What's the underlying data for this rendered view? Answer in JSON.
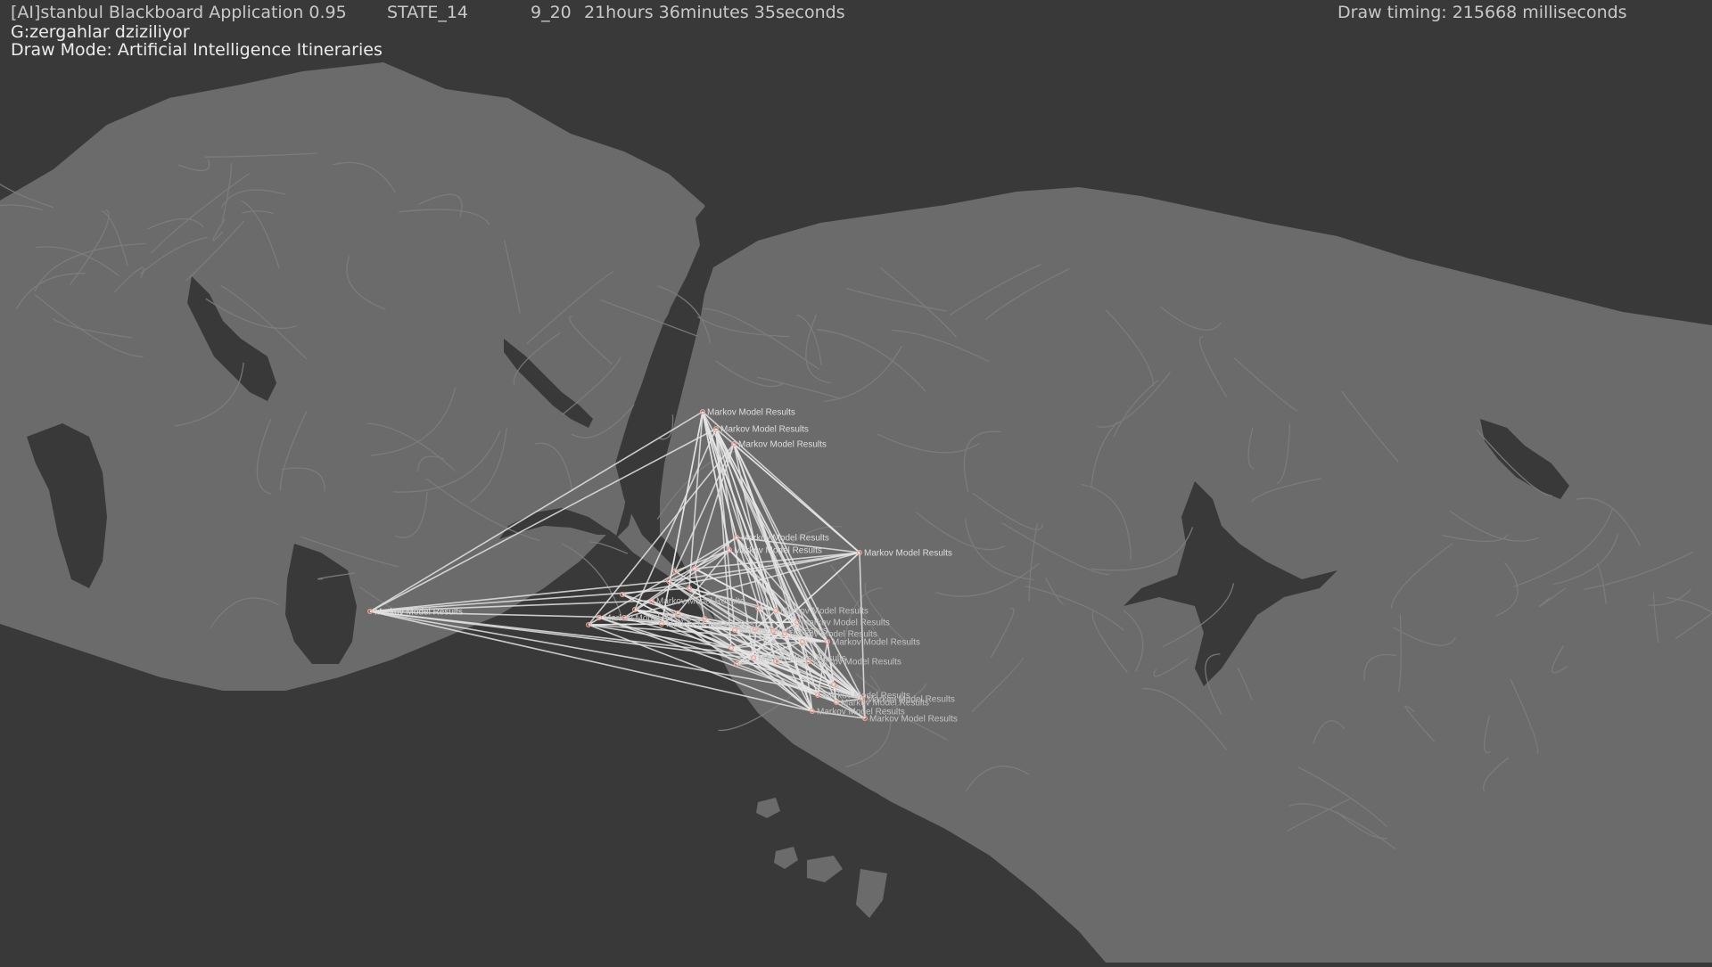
{
  "app": {
    "title": "[AI]stanbul Blackboard Application 0.95",
    "state": "STATE_14",
    "date_code": "9_20",
    "elapsed": "21hours 36minutes 35seconds",
    "draw_timing": "Draw timing: 215668 milliseconds",
    "status_line": "G:zergahlar dziziliyor",
    "draw_mode": "Draw Mode: Artificial Intelligence Itineraries"
  },
  "map": {
    "land_color": "#6b6b6b",
    "water_color": "#393939",
    "road_color": "#7e7e7e",
    "route_color": "#e4e4e4",
    "marker_color": "#f0a494",
    "point_label": "Markov Model Results"
  }
}
